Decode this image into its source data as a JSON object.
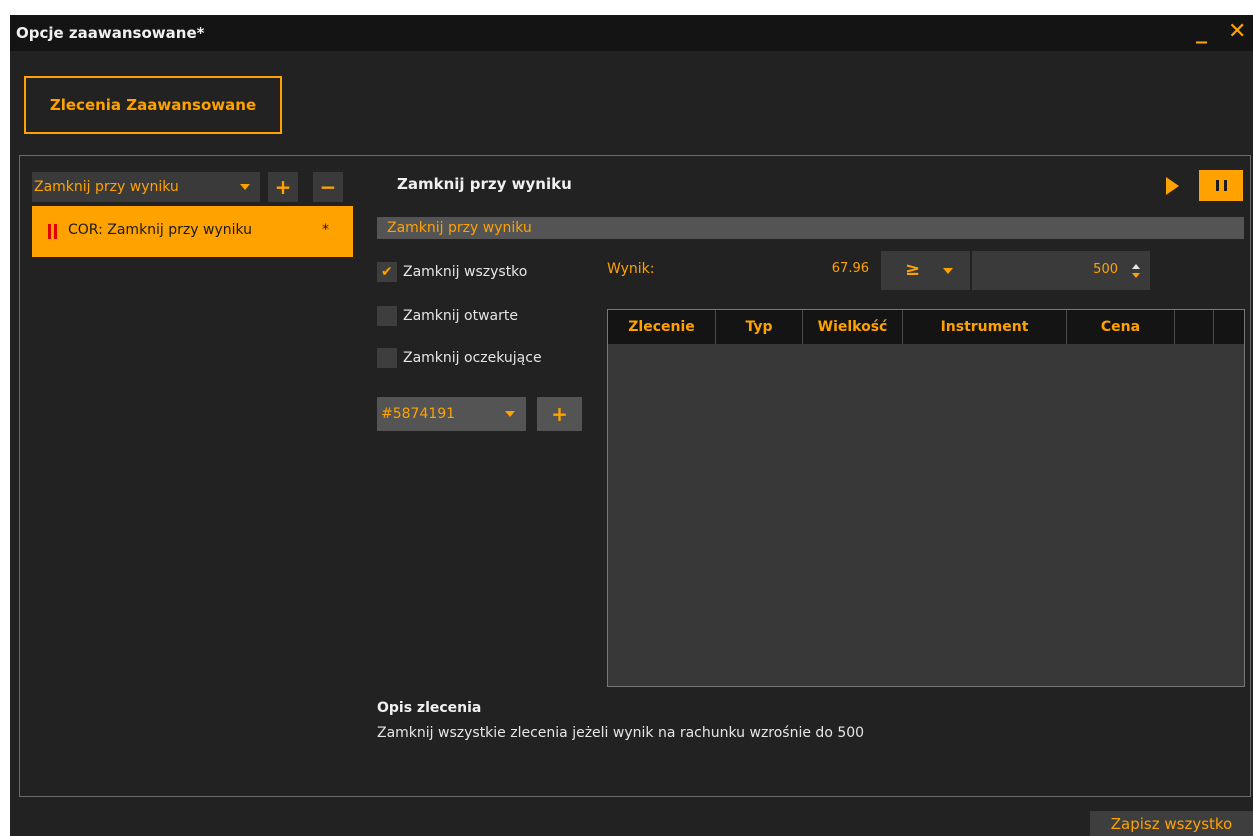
{
  "window": {
    "title": "Opcje zaawansowane*",
    "minimize_glyph": "_",
    "close_glyph": "✕"
  },
  "main_tab": {
    "label": "Zlecenia Zaawansowane"
  },
  "left_panel": {
    "rule_type_select": "Zamknij przy wyniku",
    "add_glyph": "+",
    "remove_glyph": "−",
    "rules": [
      {
        "label": "COR: Zamknij przy wyniku",
        "modified": "*",
        "state_icon": "pause-icon"
      }
    ]
  },
  "editor": {
    "section_title": "Zamknij przy wyniku",
    "name_value": "Zamknij przy wyniku",
    "checkboxes": [
      {
        "label": "Zamknij wszystko",
        "checked": true
      },
      {
        "label": "Zamknij otwarte",
        "checked": false
      },
      {
        "label": "Zamknij oczekujące",
        "checked": false
      }
    ],
    "check_glyph": "✔",
    "result_label": "Wynik:",
    "result_value": "67.96",
    "operator": "≥",
    "target_value": "500",
    "account_select": "#5874191",
    "account_add_glyph": "+",
    "table": {
      "columns": [
        "Zlecenie",
        "Typ",
        "Wielkość",
        "Instrument",
        "Cena",
        "",
        ""
      ],
      "rows": []
    },
    "description_title": "Opis zlecenia",
    "description_text": "Zamknij wszystkie zlecenia jeżeli wynik na rachunku wzrośnie do 500"
  },
  "footer": {
    "save_label": "Zapisz wszystko"
  },
  "colors": {
    "accent": "#ffa200",
    "background": "#222222",
    "titlebar": "#141414",
    "status_red": "#e00000"
  }
}
